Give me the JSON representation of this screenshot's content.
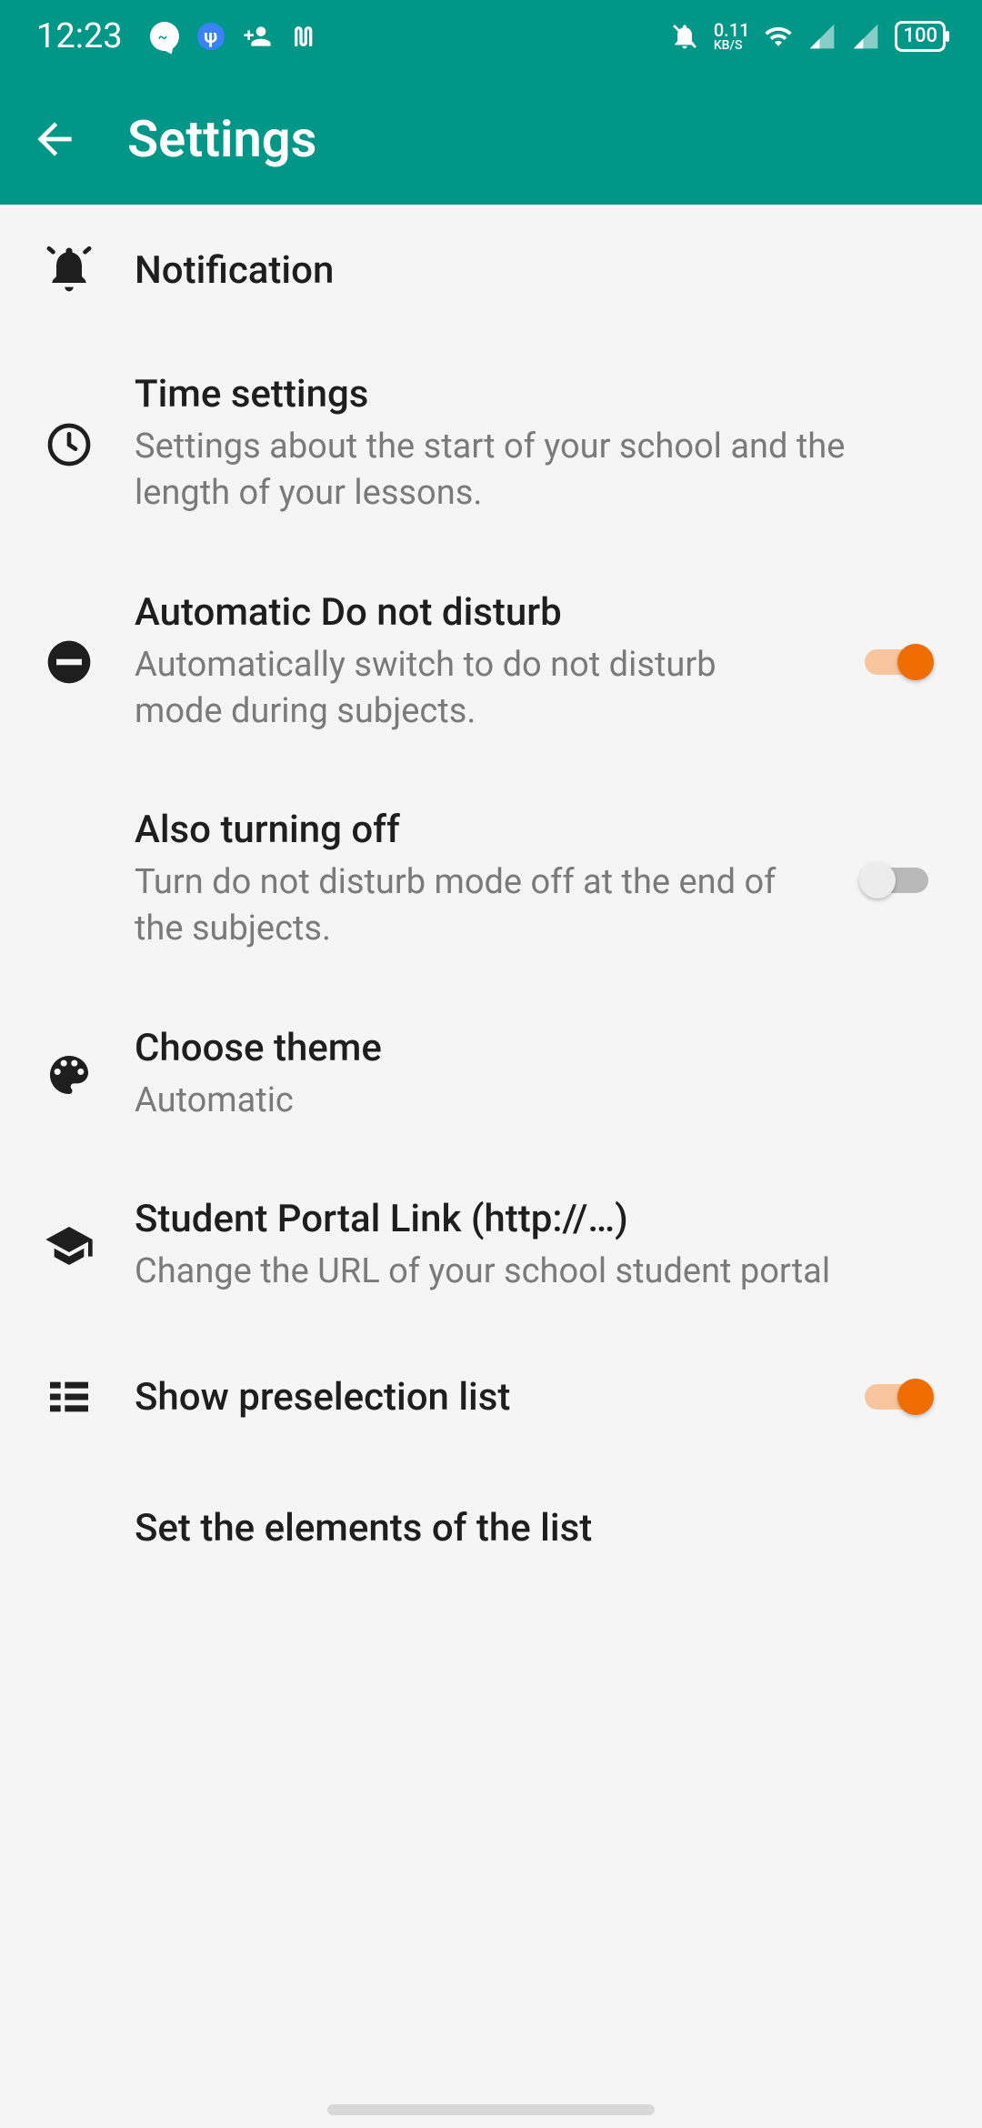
{
  "status": {
    "time": "12:23",
    "net_speed_value": "0.11",
    "net_speed_unit": "KB/S",
    "battery": "100"
  },
  "appbar": {
    "title": "Settings"
  },
  "rows": {
    "notification": {
      "title": "Notification"
    },
    "time_settings": {
      "title": "Time settings",
      "sub": "Settings about the start of your school and the length of your lessons."
    },
    "dnd_auto": {
      "title": "Automatic Do not disturb",
      "sub": "Automatically switch to do not disturb mode during subjects.",
      "on": true
    },
    "dnd_off": {
      "title": "Also turning off",
      "sub": "Turn do not disturb mode off at the end of the subjects.",
      "on": false
    },
    "theme": {
      "title": "Choose theme",
      "sub": "Automatic"
    },
    "portal": {
      "title": "Student Portal Link (http://…)",
      "sub": "Change the URL of your school student portal"
    },
    "preselection": {
      "title": "Show preselection list",
      "on": true
    },
    "set_elements": {
      "title": "Set the elements of the list"
    }
  },
  "colors": {
    "accent": "#009688",
    "switch_on": "#ef6c00"
  }
}
